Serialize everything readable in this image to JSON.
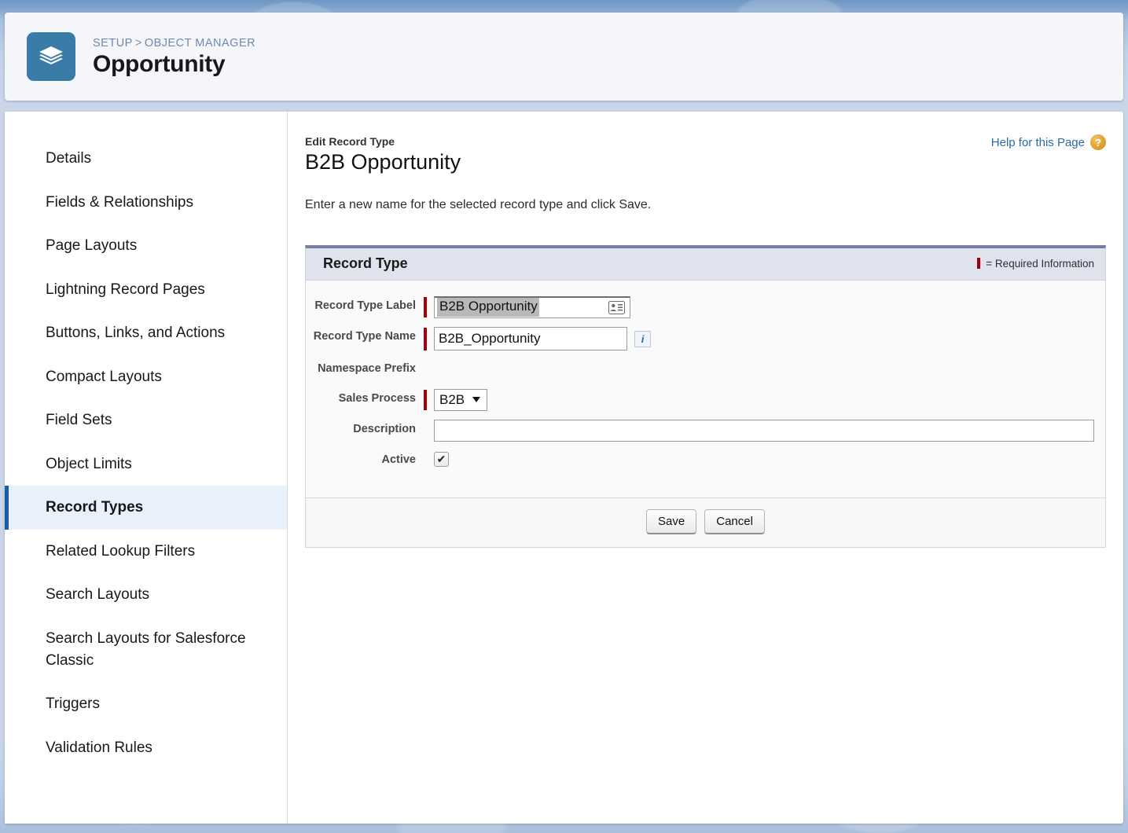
{
  "header": {
    "breadcrumb": {
      "setup": "SETUP",
      "separator": ">",
      "object_manager": "OBJECT MANAGER"
    },
    "title": "Opportunity",
    "icon": "layers-stack-icon",
    "icon_color": "#3a7ca8"
  },
  "sidebar": {
    "items": [
      {
        "label": "Details",
        "active": false
      },
      {
        "label": "Fields & Relationships",
        "active": false
      },
      {
        "label": "Page Layouts",
        "active": false
      },
      {
        "label": "Lightning Record Pages",
        "active": false
      },
      {
        "label": "Buttons, Links, and Actions",
        "active": false
      },
      {
        "label": "Compact Layouts",
        "active": false
      },
      {
        "label": "Field Sets",
        "active": false
      },
      {
        "label": "Object Limits",
        "active": false
      },
      {
        "label": "Record Types",
        "active": true
      },
      {
        "label": "Related Lookup Filters",
        "active": false
      },
      {
        "label": "Search Layouts",
        "active": false
      },
      {
        "label": "Search Layouts for Salesforce Classic",
        "active": false
      },
      {
        "label": "Triggers",
        "active": false
      },
      {
        "label": "Validation Rules",
        "active": false
      }
    ],
    "active_color": "#1b5ea8",
    "active_bg": "#e8f1fb"
  },
  "content": {
    "help_link": "Help for this Page",
    "help_icon": "question-mark-badge-icon",
    "eyebrow": "Edit Record Type",
    "record_title": "B2B Opportunity",
    "intro": "Enter a new name for the selected record type and click Save."
  },
  "panel": {
    "title": "Record Type",
    "required_legend": "= Required Information",
    "required_color": "#a3000b",
    "fields": {
      "record_type_label": {
        "label": "Record Type Label",
        "value": "B2B Opportunity",
        "required": true,
        "selected": true,
        "icon": "contact-card-autofill-icon"
      },
      "record_type_name": {
        "label": "Record Type Name",
        "value": "B2B_Opportunity",
        "required": true,
        "info_icon": "info-i-icon",
        "info_icon_label": "i"
      },
      "namespace_prefix": {
        "label": "Namespace Prefix",
        "value": "",
        "required": false
      },
      "sales_process": {
        "label": "Sales Process",
        "value": "B2B",
        "required": true,
        "options": [
          "B2B"
        ]
      },
      "description": {
        "label": "Description",
        "value": "",
        "placeholder": "",
        "required": false
      },
      "active": {
        "label": "Active",
        "checked": true,
        "check_glyph": "✔"
      }
    },
    "buttons": {
      "save": "Save",
      "cancel": "Cancel"
    }
  }
}
